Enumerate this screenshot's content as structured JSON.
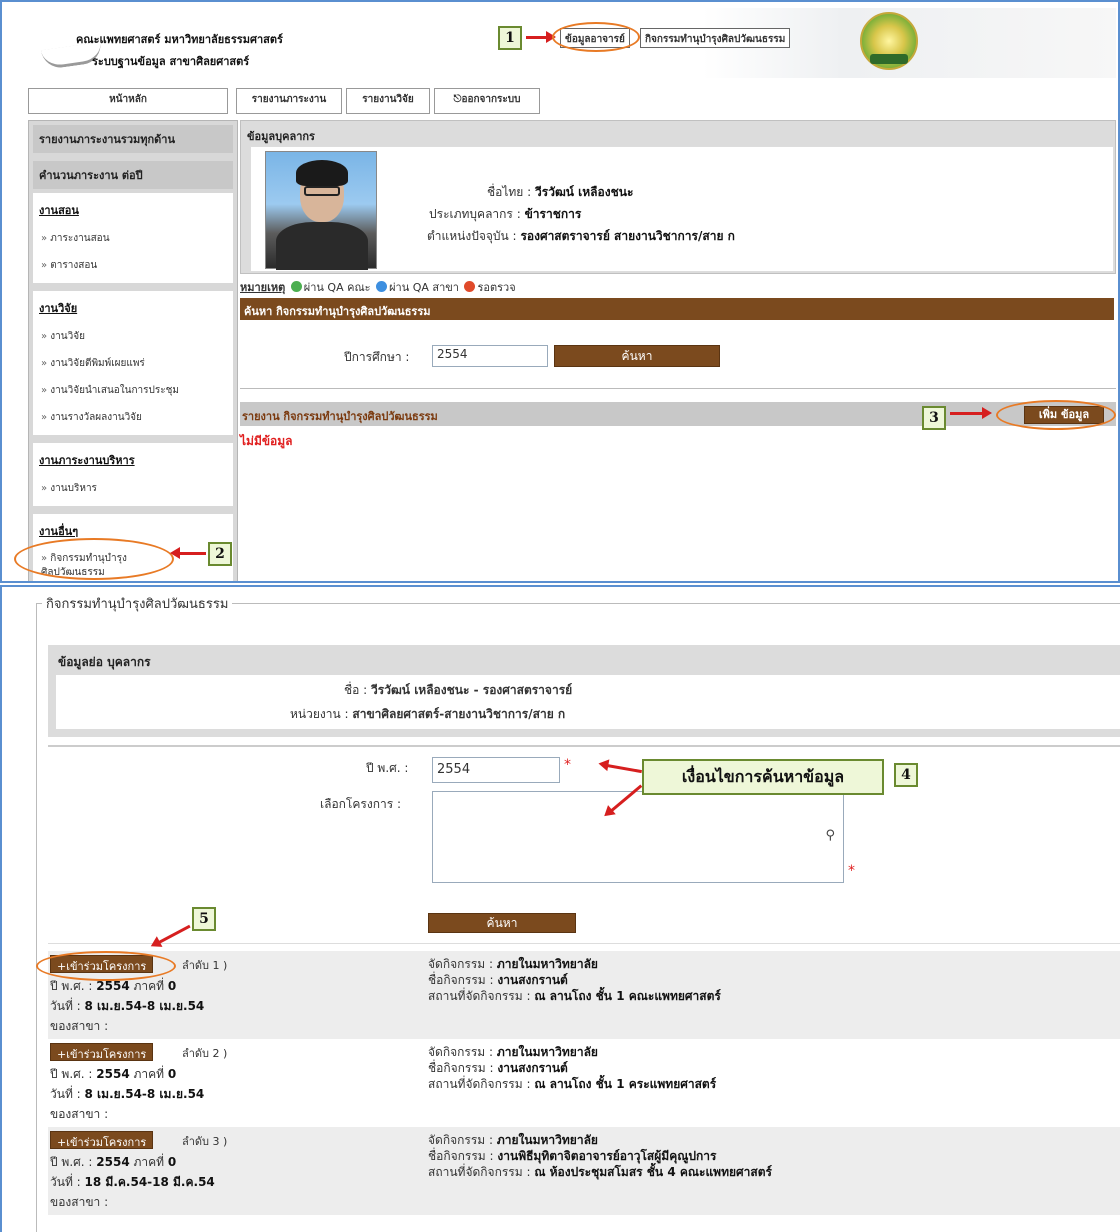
{
  "header": {
    "faculty": "คณะแพทยศาสตร์ มหาวิทยาลัยธรรมศาสตร์",
    "system": "ระบบฐานข้อมูล สาขาศิลยศาสตร์",
    "nav": [
      "ข้อมูลอาจารย์",
      "กิจกรรมทำนุบำรุงศิลปวัฒนธรรม"
    ]
  },
  "menu": [
    "หน้าหลัก",
    "รายงานภาระงาน",
    "รายงานวิจัย",
    "ออกจากระบบ"
  ],
  "sidebar": {
    "headers": [
      "รายงานภาระงานรวมทุกด้าน",
      "คำนวนภาระงาน ต่อปี"
    ],
    "sections": [
      {
        "title": "งานสอน",
        "items": [
          "ภาระงานสอน",
          "ตารางสอน"
        ]
      },
      {
        "title": "งานวิจัย",
        "items": [
          "งานวิจัย",
          "งานวิจัยตีพิมพ์เผยแพร่",
          "งานวิจัยนำเสนอในการประชุม",
          "งานรางวัลผลงานวิจัย"
        ]
      },
      {
        "title": "งานภาระงานบริหาร",
        "items": [
          "งานบริหาร"
        ]
      },
      {
        "title": "งานอื่นๆ",
        "items": [
          "กิจกรรมทำนุบำรุง ศิลปวัฒนธรรม"
        ]
      }
    ]
  },
  "personnel": {
    "title": "ข้อมูลบุคลากร",
    "name_label": "ชื่อไทย :",
    "name": "วีรวัฒน์ เหลืองชนะ",
    "type_label": "ประเภทบุคลากร :",
    "type": "ข้าราชการ",
    "position_label": "ตำแหน่งปัจจุบัน :",
    "position": "รองศาสตราจารย์ สายงานวิชาการ/สาย ก"
  },
  "legend": {
    "note": "หมายเหตุ",
    "pass_faculty": "ผ่าน QA คณะ",
    "pass_branch": "ผ่าน QA สาขา",
    "pending": "รอตรวจ",
    "colors": {
      "green": "#4caf50",
      "blue": "#3d8fe0",
      "red": "#e04a2a"
    }
  },
  "search_top": {
    "bar": "ค้นหา กิจกรรมทำนุบำรุงศิลปวัฒนธรรม",
    "year_label": "ปีการศึกษา :",
    "year": "2554",
    "button": "ค้นหา"
  },
  "report": {
    "bar": "รายงาน กิจกรรมทำนุบำรุงศิลปวัฒนธรรม",
    "add_button": "เพิ่ม ข้อมูล",
    "empty": "ไม่มีข้อมูล"
  },
  "callouts": [
    "1",
    "2",
    "3",
    "4",
    "5"
  ],
  "callout4_text": "เงื่อนไขการค้นหาข้อมูล",
  "form": {
    "legend": "กิจกรรมทำนุบำรุงศิลปวัฒนธรรม",
    "brief_title": "ข้อมูลย่อ บุคลากร",
    "name_label": "ชื่อ :",
    "name": "วีรวัฒน์ เหลืองชนะ - รองศาสตราจารย์",
    "unit_label": "หน่วยงาน :",
    "unit": "สาขาศิลยศาสตร์-สายงานวิชาการ/สาย ก",
    "year_label": "ปี พ.ศ. :",
    "year": "2554",
    "project_label": "เลือกโครงการ :",
    "search_button": "ค้นหา",
    "required": "*"
  },
  "projects": [
    {
      "join": "+เข้าร่วมโครงการ",
      "seq": "ลำดับ 1 )",
      "year_line": "ปี พ.ศ. : ",
      "year": "2554",
      "term_label": " ภาคที่ ",
      "term": "0",
      "date_label": "วันที่ : ",
      "date": "8 เม.ย.54-8 เม.ย.54",
      "branch": "ของสาขา :",
      "org_label": "จัดกิจกรรม : ",
      "org": "ภายในมหาวิทยาลัย",
      "name_label": "ชื่อกิจกรรม : ",
      "name": "งานสงกรานต์",
      "place_label": "สถานที่จัดกิจกรรม : ",
      "place": "ณ ลานโถง ชั้น 1 คณะแพทยศาสตร์"
    },
    {
      "join": "+เข้าร่วมโครงการ",
      "seq": "ลำดับ 2 )",
      "year_line": "ปี พ.ศ. : ",
      "year": "2554",
      "term_label": " ภาคที่ ",
      "term": "0",
      "date_label": "วันที่ : ",
      "date": "8 เม.ย.54-8 เม.ย.54",
      "branch": "ของสาขา :",
      "org_label": "จัดกิจกรรม : ",
      "org": "ภายในมหาวิทยาลัย",
      "name_label": "ชื่อกิจกรรม : ",
      "name": "งานสงกรานต์",
      "place_label": "สถานที่จัดกิจกรรม : ",
      "place": "ณ ลานโถง ชั้น 1 คระแพทยศาสตร์"
    },
    {
      "join": "+เข้าร่วมโครงการ",
      "seq": "ลำดับ 3 )",
      "year_line": "ปี พ.ศ. : ",
      "year": "2554",
      "term_label": " ภาคที่ ",
      "term": "0",
      "date_label": "วันที่ : ",
      "date": "18 มี.ค.54-18 มี.ค.54",
      "branch": "ของสาขา :",
      "org_label": "จัดกิจกรรม : ",
      "org": "ภายในมหาวิทยาลัย",
      "name_label": "ชื่อกิจกรรม : ",
      "name": "งานพิธีมุทิตาจิตอาจารย์อาวุโสผู้มีคุณูปการ",
      "place_label": "สถานที่จัดกิจกรรม : ",
      "place": "ณ ห้องประชุมสโมสร ชั้น 4 คณะแพทยศาสตร์"
    }
  ]
}
